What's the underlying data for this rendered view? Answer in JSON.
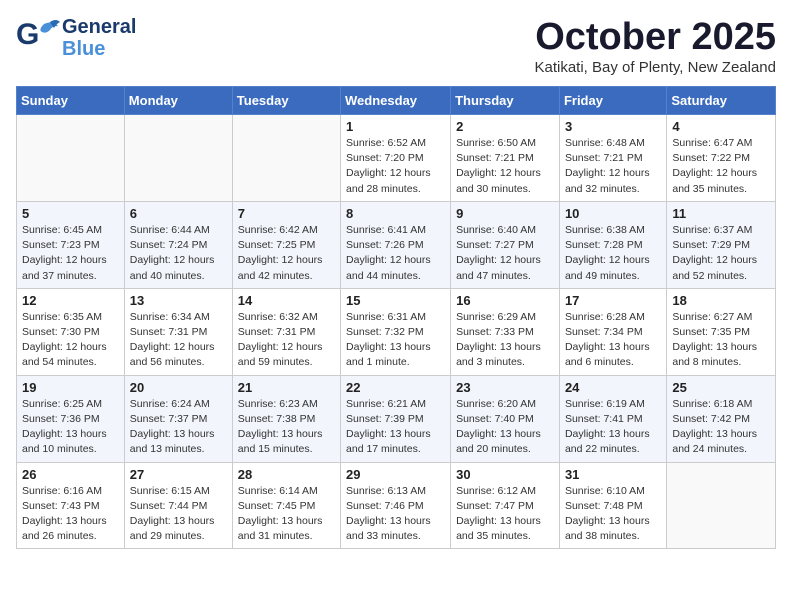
{
  "header": {
    "logo_line1": "General",
    "logo_line2": "Blue",
    "month": "October 2025",
    "location": "Katikati, Bay of Plenty, New Zealand"
  },
  "weekdays": [
    "Sunday",
    "Monday",
    "Tuesday",
    "Wednesday",
    "Thursday",
    "Friday",
    "Saturday"
  ],
  "weeks": [
    [
      {
        "day": "",
        "info": ""
      },
      {
        "day": "",
        "info": ""
      },
      {
        "day": "",
        "info": ""
      },
      {
        "day": "1",
        "info": "Sunrise: 6:52 AM\nSunset: 7:20 PM\nDaylight: 12 hours\nand 28 minutes."
      },
      {
        "day": "2",
        "info": "Sunrise: 6:50 AM\nSunset: 7:21 PM\nDaylight: 12 hours\nand 30 minutes."
      },
      {
        "day": "3",
        "info": "Sunrise: 6:48 AM\nSunset: 7:21 PM\nDaylight: 12 hours\nand 32 minutes."
      },
      {
        "day": "4",
        "info": "Sunrise: 6:47 AM\nSunset: 7:22 PM\nDaylight: 12 hours\nand 35 minutes."
      }
    ],
    [
      {
        "day": "5",
        "info": "Sunrise: 6:45 AM\nSunset: 7:23 PM\nDaylight: 12 hours\nand 37 minutes."
      },
      {
        "day": "6",
        "info": "Sunrise: 6:44 AM\nSunset: 7:24 PM\nDaylight: 12 hours\nand 40 minutes."
      },
      {
        "day": "7",
        "info": "Sunrise: 6:42 AM\nSunset: 7:25 PM\nDaylight: 12 hours\nand 42 minutes."
      },
      {
        "day": "8",
        "info": "Sunrise: 6:41 AM\nSunset: 7:26 PM\nDaylight: 12 hours\nand 44 minutes."
      },
      {
        "day": "9",
        "info": "Sunrise: 6:40 AM\nSunset: 7:27 PM\nDaylight: 12 hours\nand 47 minutes."
      },
      {
        "day": "10",
        "info": "Sunrise: 6:38 AM\nSunset: 7:28 PM\nDaylight: 12 hours\nand 49 minutes."
      },
      {
        "day": "11",
        "info": "Sunrise: 6:37 AM\nSunset: 7:29 PM\nDaylight: 12 hours\nand 52 minutes."
      }
    ],
    [
      {
        "day": "12",
        "info": "Sunrise: 6:35 AM\nSunset: 7:30 PM\nDaylight: 12 hours\nand 54 minutes."
      },
      {
        "day": "13",
        "info": "Sunrise: 6:34 AM\nSunset: 7:31 PM\nDaylight: 12 hours\nand 56 minutes."
      },
      {
        "day": "14",
        "info": "Sunrise: 6:32 AM\nSunset: 7:31 PM\nDaylight: 12 hours\nand 59 minutes."
      },
      {
        "day": "15",
        "info": "Sunrise: 6:31 AM\nSunset: 7:32 PM\nDaylight: 13 hours\nand 1 minute."
      },
      {
        "day": "16",
        "info": "Sunrise: 6:29 AM\nSunset: 7:33 PM\nDaylight: 13 hours\nand 3 minutes."
      },
      {
        "day": "17",
        "info": "Sunrise: 6:28 AM\nSunset: 7:34 PM\nDaylight: 13 hours\nand 6 minutes."
      },
      {
        "day": "18",
        "info": "Sunrise: 6:27 AM\nSunset: 7:35 PM\nDaylight: 13 hours\nand 8 minutes."
      }
    ],
    [
      {
        "day": "19",
        "info": "Sunrise: 6:25 AM\nSunset: 7:36 PM\nDaylight: 13 hours\nand 10 minutes."
      },
      {
        "day": "20",
        "info": "Sunrise: 6:24 AM\nSunset: 7:37 PM\nDaylight: 13 hours\nand 13 minutes."
      },
      {
        "day": "21",
        "info": "Sunrise: 6:23 AM\nSunset: 7:38 PM\nDaylight: 13 hours\nand 15 minutes."
      },
      {
        "day": "22",
        "info": "Sunrise: 6:21 AM\nSunset: 7:39 PM\nDaylight: 13 hours\nand 17 minutes."
      },
      {
        "day": "23",
        "info": "Sunrise: 6:20 AM\nSunset: 7:40 PM\nDaylight: 13 hours\nand 20 minutes."
      },
      {
        "day": "24",
        "info": "Sunrise: 6:19 AM\nSunset: 7:41 PM\nDaylight: 13 hours\nand 22 minutes."
      },
      {
        "day": "25",
        "info": "Sunrise: 6:18 AM\nSunset: 7:42 PM\nDaylight: 13 hours\nand 24 minutes."
      }
    ],
    [
      {
        "day": "26",
        "info": "Sunrise: 6:16 AM\nSunset: 7:43 PM\nDaylight: 13 hours\nand 26 minutes."
      },
      {
        "day": "27",
        "info": "Sunrise: 6:15 AM\nSunset: 7:44 PM\nDaylight: 13 hours\nand 29 minutes."
      },
      {
        "day": "28",
        "info": "Sunrise: 6:14 AM\nSunset: 7:45 PM\nDaylight: 13 hours\nand 31 minutes."
      },
      {
        "day": "29",
        "info": "Sunrise: 6:13 AM\nSunset: 7:46 PM\nDaylight: 13 hours\nand 33 minutes."
      },
      {
        "day": "30",
        "info": "Sunrise: 6:12 AM\nSunset: 7:47 PM\nDaylight: 13 hours\nand 35 minutes."
      },
      {
        "day": "31",
        "info": "Sunrise: 6:10 AM\nSunset: 7:48 PM\nDaylight: 13 hours\nand 38 minutes."
      },
      {
        "day": "",
        "info": ""
      }
    ]
  ]
}
